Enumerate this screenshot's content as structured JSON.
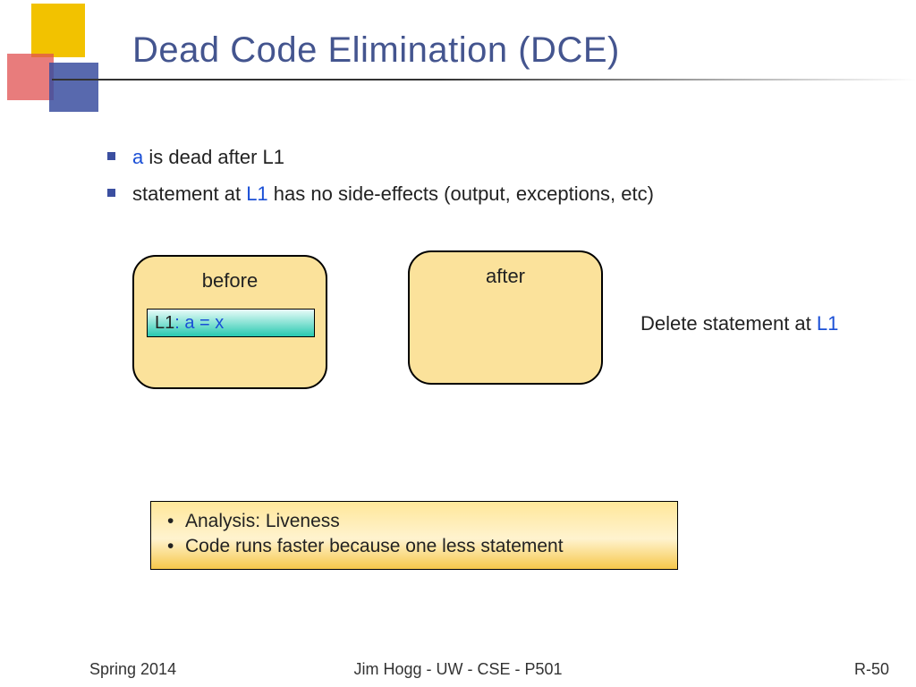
{
  "title": "Dead Code Elimination (DCE)",
  "bullets": [
    {
      "kw": "a",
      "rest": " is dead after L1"
    },
    {
      "pre": "statement at ",
      "kw": "L1",
      "rest": " has no side-effects (output, exceptions, etc)"
    }
  ],
  "boxes": {
    "before": {
      "label": "before",
      "code_label": "L1",
      "code_body": ": a = x"
    },
    "after": {
      "label": "after"
    }
  },
  "delete_note": {
    "pre": "Delete statement at ",
    "kw": "L1"
  },
  "summary": [
    "Analysis: Liveness",
    "Code runs faster because one less statement"
  ],
  "footer": {
    "left": "Spring 2014",
    "center": "Jim Hogg - UW - CSE - P501",
    "right": "R-50"
  }
}
